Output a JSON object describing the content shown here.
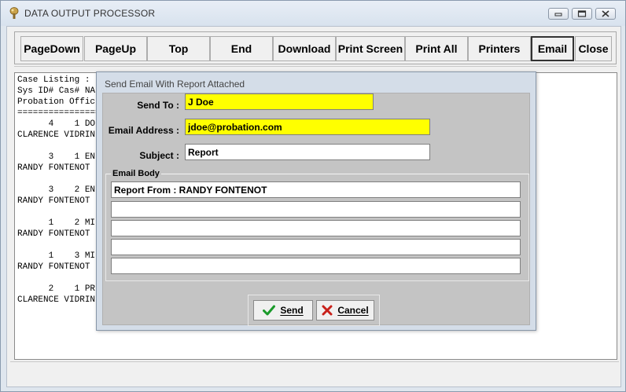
{
  "window": {
    "title": "DATA OUTPUT PROCESSOR"
  },
  "toolbar": {
    "buttons": [
      {
        "id": "pagedown",
        "label": "PageDown"
      },
      {
        "id": "pageup",
        "label": "PageUp"
      },
      {
        "id": "top",
        "label": "Top"
      },
      {
        "id": "end",
        "label": "End"
      },
      {
        "id": "download",
        "label": "Download"
      },
      {
        "id": "print-screen",
        "label": "Print Screen"
      },
      {
        "id": "print-all",
        "label": "Print All"
      },
      {
        "id": "printers",
        "label": "Printers"
      },
      {
        "id": "email",
        "label": "Email"
      },
      {
        "id": "close",
        "label": "Close"
      }
    ]
  },
  "report": {
    "lines": [
      "Case Listing :",
      "Sys ID# Cas# NA",
      "Probation Offic",
      "================",
      "      4    1 DO",
      "CLARENCE VIDRIN",
      "",
      "      3    1 EN",
      "RANDY FONTENOT",
      "",
      "      3    2 EN",
      "RANDY FONTENOT",
      "",
      "      1    2 MI",
      "RANDY FONTENOT",
      "",
      "      1    3 MI",
      "RANDY FONTENOT",
      "",
      "      2    1 PR",
      "CLARENCE VIDRIN"
    ]
  },
  "dialog": {
    "title": "Send Email With Report Attached",
    "send_to_label": "Send To :",
    "send_to_value": "J Doe",
    "email_label": "Email Address :",
    "email_value": "jdoe@probation.com",
    "subject_label": "Subject :",
    "subject_value": "Report",
    "body_label": "Email Body",
    "body_lines": [
      "Report From : RANDY FONTENOT",
      "",
      "",
      "",
      ""
    ],
    "send_label": "Send",
    "cancel_label": "Cancel"
  }
}
